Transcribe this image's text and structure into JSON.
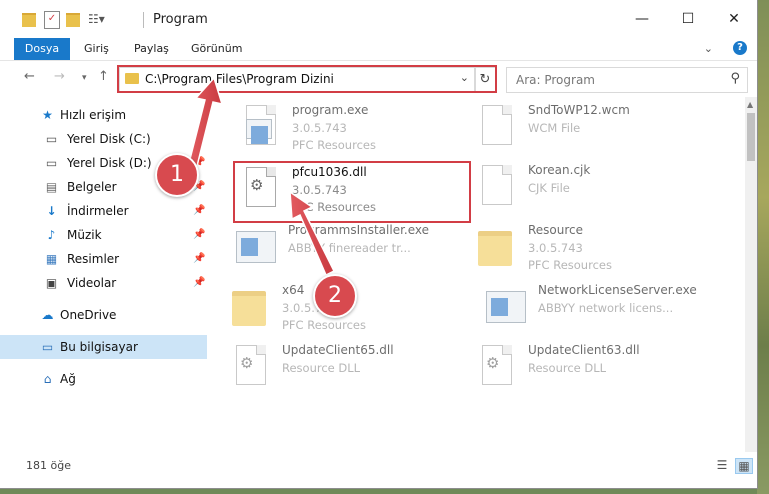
{
  "window": {
    "title": "Program",
    "minimize": "—",
    "maximize": "☐",
    "close": "✕"
  },
  "ribbon": {
    "tabs": [
      "Dosya",
      "Giriş",
      "Paylaş",
      "Görünüm"
    ],
    "help": "?"
  },
  "address": {
    "path": "C:\\Program Files\\Program Dizini",
    "search_placeholder": "Ara: Program"
  },
  "nav": {
    "quick_access": "Hızlı erişim",
    "items": [
      {
        "label": "Yerel Disk (C:)",
        "icon": "drive-icon"
      },
      {
        "label": "Yerel Disk (D:)",
        "icon": "drive-icon"
      },
      {
        "label": "Belgeler",
        "icon": "documents-icon"
      },
      {
        "label": "İndirmeler",
        "icon": "download-icon"
      },
      {
        "label": "Müzik",
        "icon": "music-icon"
      },
      {
        "label": "Resimler",
        "icon": "pictures-icon"
      },
      {
        "label": "Videolar",
        "icon": "videos-icon"
      }
    ],
    "onedrive": "OneDrive",
    "this_pc": "Bu bilgisayar",
    "network": "Ağ"
  },
  "files": [
    {
      "name": "program.exe",
      "line2": "3.0.5.743",
      "line3": "PFC Resources",
      "icon": "app-icon"
    },
    {
      "name": "SndToWP12.wcm",
      "line2": "WCM File",
      "line3": "",
      "icon": "file-icon"
    },
    {
      "name": "pfcu1036.dll",
      "line2": "3.0.5.743",
      "line3": "PFC Resources",
      "icon": "dll-icon"
    },
    {
      "name": "Korean.cjk",
      "line2": "CJK File",
      "line3": "",
      "icon": "file-icon"
    },
    {
      "name": "ProgrammsInstaller.exe",
      "line2": "ABBYY finereader tr...",
      "line3": "",
      "icon": "installer-icon"
    },
    {
      "name": "Resource",
      "line2": "3.0.5.743",
      "line3": "PFC Resources",
      "icon": "folder-icon"
    },
    {
      "name": "x64",
      "line2": "3.0.5.743",
      "line3": "PFC Resources",
      "icon": "folder-icon"
    },
    {
      "name": "NetworkLicenseServer.exe",
      "line2": "ABBYY network licens...",
      "line3": "",
      "icon": "installer-icon"
    },
    {
      "name": "UpdateClient65.dll",
      "line2": "Resource DLL",
      "line3": "",
      "icon": "dll-icon"
    },
    {
      "name": "UpdateClient63.dll",
      "line2": "Resource DLL",
      "line3": "",
      "icon": "dll-icon"
    }
  ],
  "status": {
    "count": "181 öğe"
  },
  "callouts": [
    "1",
    "2"
  ],
  "colors": {
    "accent": "#1979ca",
    "highlight": "#d23d45",
    "callout": "#d84a4f",
    "selection": "#cce4f7"
  }
}
